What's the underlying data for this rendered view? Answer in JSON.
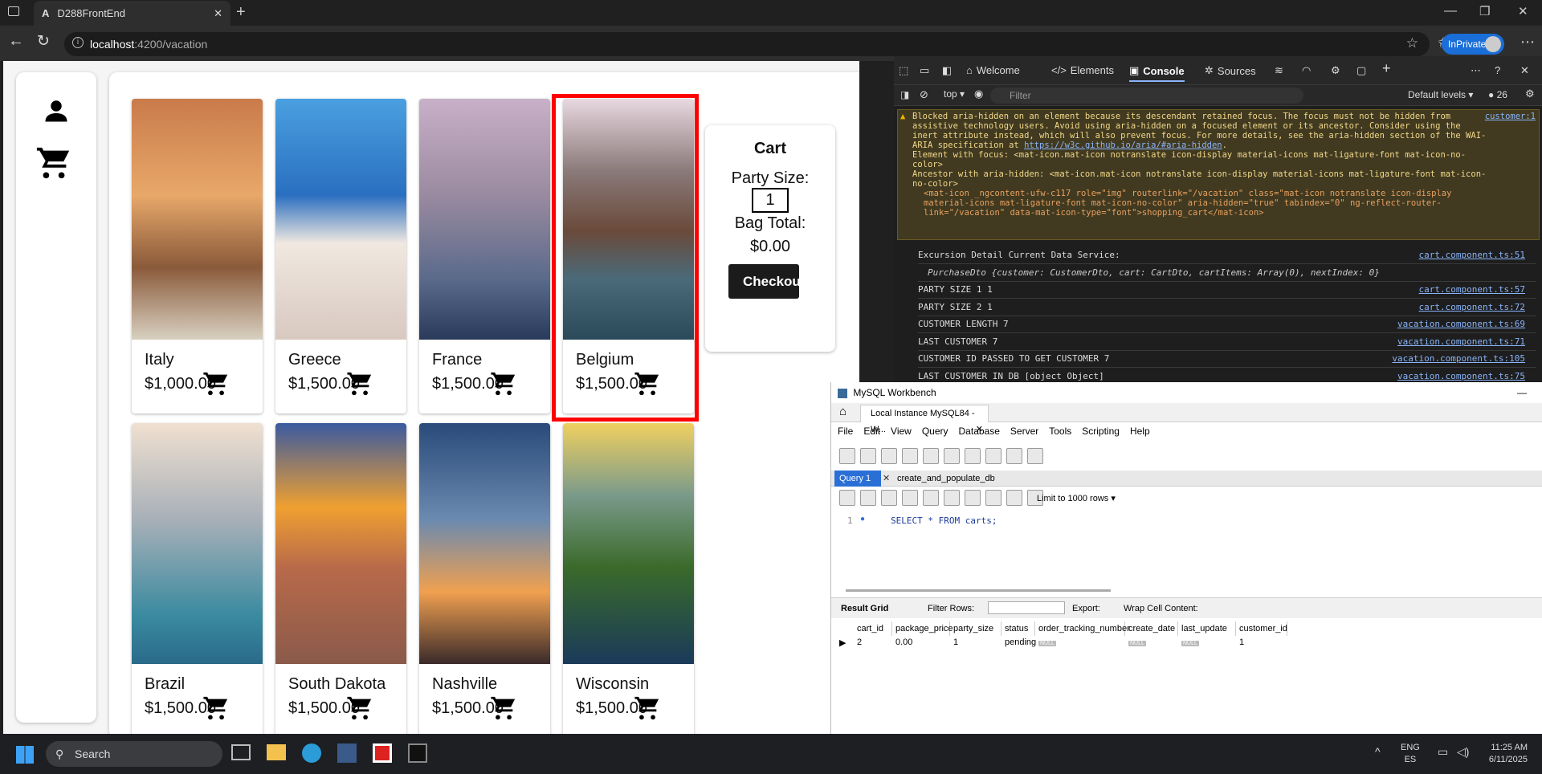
{
  "browser": {
    "tab_title": "D288FrontEnd",
    "url_host": "localhost",
    "url_rest": ":4200/vacation",
    "profile": "InPrivate"
  },
  "vacations": [
    {
      "name": "Italy",
      "price": "$1,000.00"
    },
    {
      "name": "Greece",
      "price": "$1,500.00"
    },
    {
      "name": "France",
      "price": "$1,500.00"
    },
    {
      "name": "Belgium",
      "price": "$1,500.00"
    },
    {
      "name": "Brazil",
      "price": "$1,500.00"
    },
    {
      "name": "South Dakota",
      "price": "$1,500.00"
    },
    {
      "name": "Nashville",
      "price": "$1,500.00"
    },
    {
      "name": "Wisconsin",
      "price": "$1,500.00"
    }
  ],
  "cart": {
    "title": "Cart",
    "party_label": "Party Size:",
    "party_value": "1",
    "bag_label": "Bag Total:",
    "bag_total": "$0.00",
    "checkout": "Checkou"
  },
  "devtools": {
    "tabs": [
      "Welcome",
      "Elements",
      "Console",
      "Sources"
    ],
    "context": "top",
    "filter_placeholder": "Filter",
    "levels": "Default levels",
    "issue_count": "26",
    "warning": {
      "text": "Blocked aria-hidden on an element because its descendant retained focus. The focus must not be hidden from assistive technology users. Avoid using aria-hidden on a focused element or its ancestor. Consider using the inert attribute instead, which will also prevent focus. For more details, see the aria-hidden section of the WAI-ARIA specification at",
      "link": "https://w3c.github.io/aria/#aria-hidden",
      "focus": "Element with focus: <mat-icon.mat-icon notranslate icon-display material-icons mat-ligature-font mat-icon-no-color>",
      "ancestor": "Ancestor with aria-hidden: <mat-icon.mat-icon notranslate icon-display material-icons mat-ligature-font mat-icon-no-color>",
      "markup": "<mat-icon _ngcontent-ufw-c117 role=\"img\" routerlink=\"/vacation\" class=\"mat-icon notranslate icon-display material-icons mat-ligature-font mat-icon-no-color\" aria-hidden=\"true\" tabindex=\"0\" ng-reflect-router-link=\"/vacation\" data-mat-icon-type=\"font\">shopping_cart</mat-icon>",
      "source": "customer:1"
    },
    "logs": [
      {
        "text": "Excursion Detail Current Data Service:",
        "src": "cart.component.ts:51"
      },
      {
        "text": "PurchaseDto {customer: CustomerDto, cart: CartDto, cartItems: Array(0), nextIndex: 0}",
        "src": ""
      },
      {
        "text": "PARTY SIZE 1 1",
        "src": "cart.component.ts:57"
      },
      {
        "text": "PARTY SIZE 2 1",
        "src": "cart.component.ts:72"
      },
      {
        "text": "CUSTOMER LENGTH 7",
        "src": "vacation.component.ts:69"
      },
      {
        "text": "LAST CUSTOMER 7",
        "src": "vacation.component.ts:71"
      },
      {
        "text": "CUSTOMER ID PASSED TO GET CUSTOMER 7",
        "src": "vacation.component.ts:105"
      },
      {
        "text": "LAST CUSTOMER IN DB [object Object]",
        "src": "vacation.component.ts:75"
      }
    ]
  },
  "workbench": {
    "title": "MySQL Workbench",
    "instance_tab": "Local Instance MySQL84 - W...",
    "menu": [
      "File",
      "Edit",
      "View",
      "Query",
      "Database",
      "Server",
      "Tools",
      "Scripting",
      "Help"
    ],
    "query_tabs": [
      "Query 1",
      "create_and_populate_db"
    ],
    "limit": "Limit to 1000 rows",
    "line_no": "1",
    "sql": "SELECT * FROM carts;",
    "result_label": "Result Grid",
    "filter_rows": "Filter Rows:",
    "export": "Export:",
    "wrap": "Wrap Cell Content:",
    "columns": [
      "cart_id",
      "package_price",
      "party_size",
      "status",
      "order_tracking_number",
      "create_date",
      "last_update",
      "customer_id"
    ],
    "row": [
      "2",
      "0.00",
      "1",
      "pending",
      "NULL",
      "NULL",
      "NULL",
      "1"
    ]
  },
  "taskbar": {
    "search": "Search",
    "lang": "ENG",
    "region": "ES",
    "time": "11:25 AM",
    "date": "6/11/2025"
  }
}
